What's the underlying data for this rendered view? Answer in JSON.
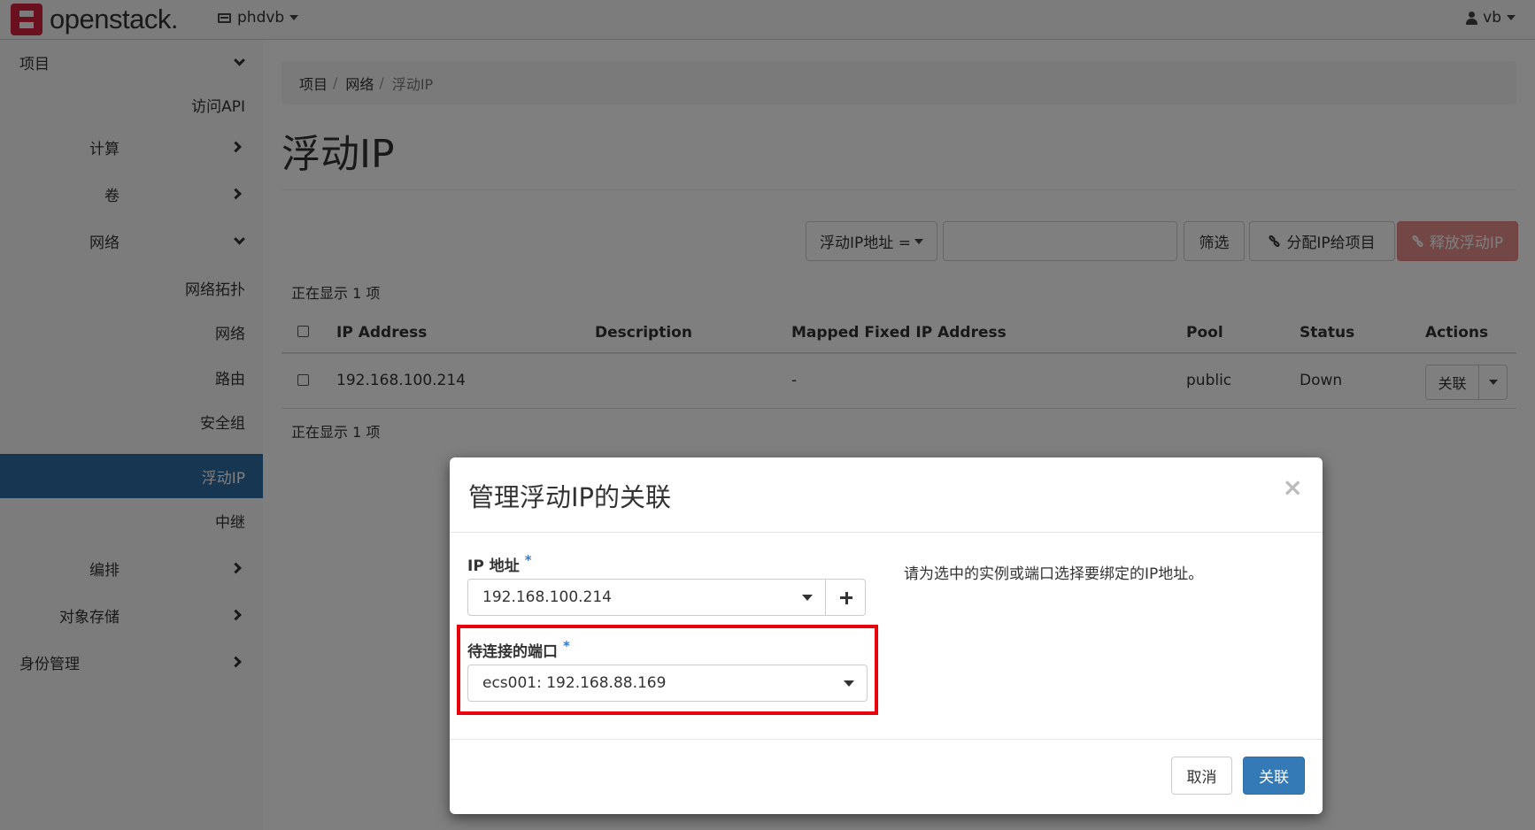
{
  "navbar": {
    "brand": "openstack.",
    "project": "phdvb",
    "user": "vb"
  },
  "sidebar": {
    "items": [
      {
        "label": "项目"
      },
      {
        "label": "访问API"
      },
      {
        "label": "计算"
      },
      {
        "label": "卷"
      },
      {
        "label": "网络"
      },
      {
        "label": "网络拓扑"
      },
      {
        "label": "网络"
      },
      {
        "label": "路由"
      },
      {
        "label": "安全组"
      },
      {
        "label": "浮动IP"
      },
      {
        "label": "中继"
      },
      {
        "label": "编排"
      },
      {
        "label": "对象存储"
      },
      {
        "label": "身份管理"
      }
    ]
  },
  "breadcrumb": [
    "项目",
    "网络",
    "浮动IP"
  ],
  "page_title": "浮动IP",
  "table_actions": {
    "filter_field": "浮动IP地址 =",
    "filter_input_value": "",
    "filter_button": "筛选",
    "allocate_button": "分配IP给项目",
    "release_button": "释放浮动IP"
  },
  "table": {
    "count_text": "正在显示 1 项",
    "columns": [
      "IP Address",
      "Description",
      "Mapped Fixed IP Address",
      "Pool",
      "Status",
      "Actions"
    ],
    "rows": [
      {
        "ip": "192.168.100.214",
        "description": "",
        "mapped": "-",
        "pool": "public",
        "status": "Down",
        "action": "关联"
      }
    ]
  },
  "modal": {
    "title": "管理浮动IP的关联",
    "close": "×",
    "ip_label": "IP 地址",
    "ip_value": "192.168.100.214",
    "port_label": "待连接的端口",
    "port_value": "ecs001: 192.168.88.169",
    "required_mark": "*",
    "help_text": "请为选中的实例或端口选择要绑定的IP地址。",
    "cancel_button": "取消",
    "submit_button": "关联"
  },
  "colors": {
    "primary": "#337ab7",
    "danger": "#d9534f",
    "sidebar_active": "#2e6da4",
    "brand_red": "#d4213d",
    "highlight": "#e8000b"
  },
  "icons": {
    "logo": "openstack-logo",
    "project": "project-list-icon",
    "user": "user-icon",
    "allocate": "link-icon",
    "release": "unlink-icon",
    "add": "plus-icon"
  }
}
